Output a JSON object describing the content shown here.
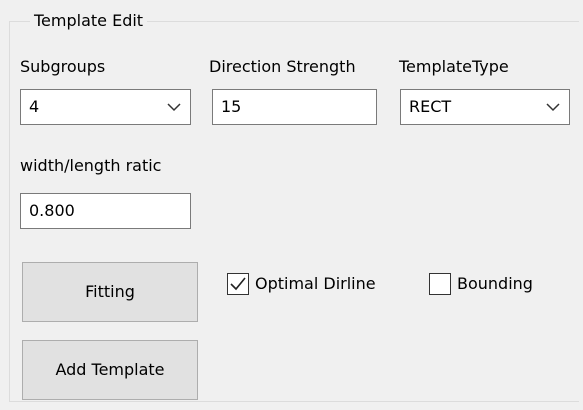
{
  "group": {
    "title": "Template Edit"
  },
  "subgroups": {
    "label": "Subgroups",
    "value": "4"
  },
  "direction_strength": {
    "label": "Direction Strength",
    "value": "15"
  },
  "template_type": {
    "label": "TemplateType",
    "value": "RECT"
  },
  "ratio": {
    "label": "width/length ratic",
    "value": "0.800"
  },
  "buttons": {
    "fitting": "Fitting",
    "add_template": "Add Template"
  },
  "checkboxes": {
    "optimal_dirline": {
      "label": "Optimal Dirline",
      "checked": true
    },
    "bounding": {
      "label": "Bounding",
      "checked": false
    }
  }
}
